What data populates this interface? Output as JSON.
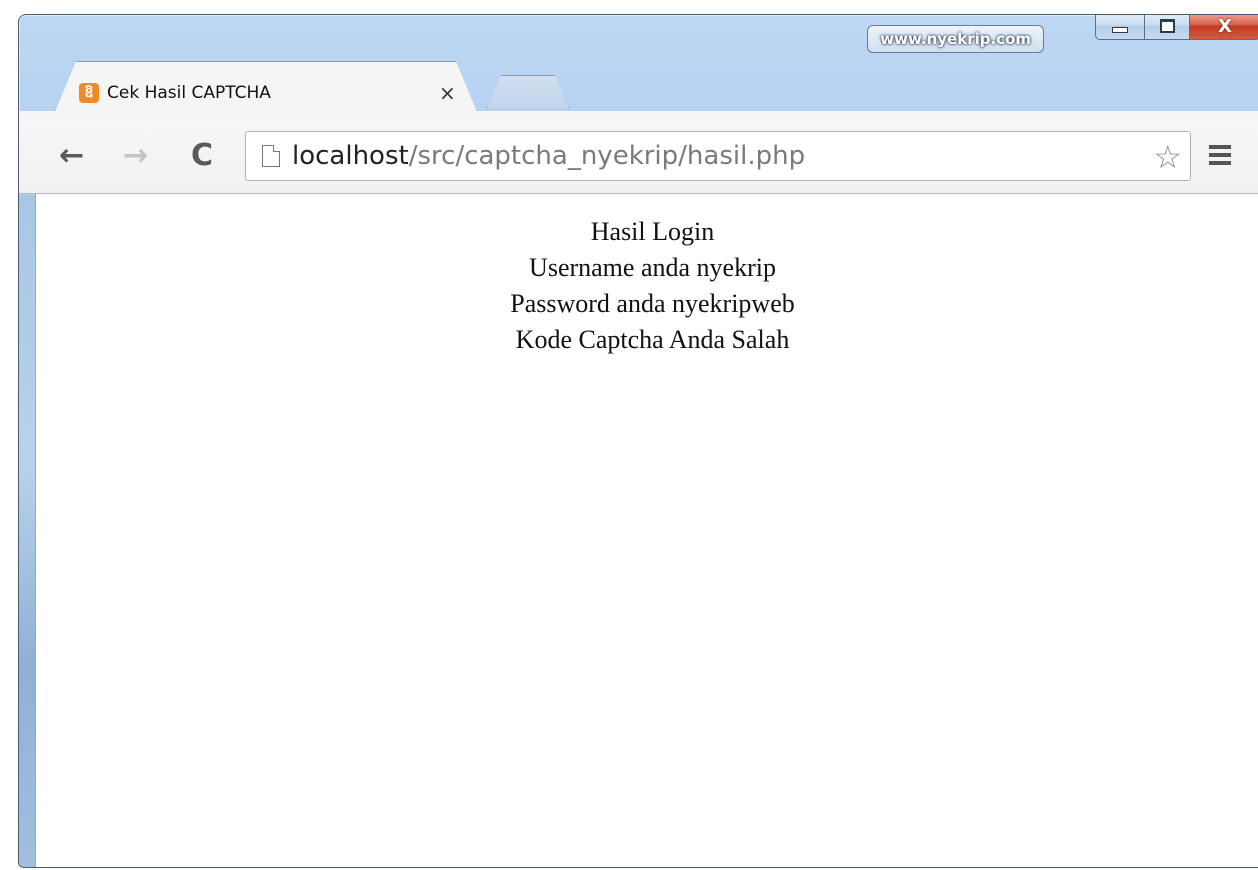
{
  "window": {
    "profile_label": "www.nyekrip.com",
    "controls": {
      "minimize_icon": "minimize-icon",
      "maximize_icon": "maximize-icon",
      "close_icon": "close-icon",
      "close_glyph": "X"
    }
  },
  "tab": {
    "title": "Cek Hasil CAPTCHA",
    "favicon": "xampp-icon",
    "favicon_glyph": "ឱ",
    "close_glyph": "×"
  },
  "toolbar": {
    "back_glyph": "←",
    "forward_glyph": "→",
    "reload_glyph": "C",
    "url_host": "localhost",
    "url_path": "/src/captcha_nyekrip/hasil.php",
    "star_glyph": "☆"
  },
  "page": {
    "lines": [
      "Hasil Login",
      "Username anda nyekrip",
      "Password anda nyekripweb",
      "Kode Captcha Anda Salah"
    ]
  },
  "colors": {
    "frame": "#a9c9ee",
    "close_button": "#c33a22",
    "favicon": "#f08a24"
  }
}
